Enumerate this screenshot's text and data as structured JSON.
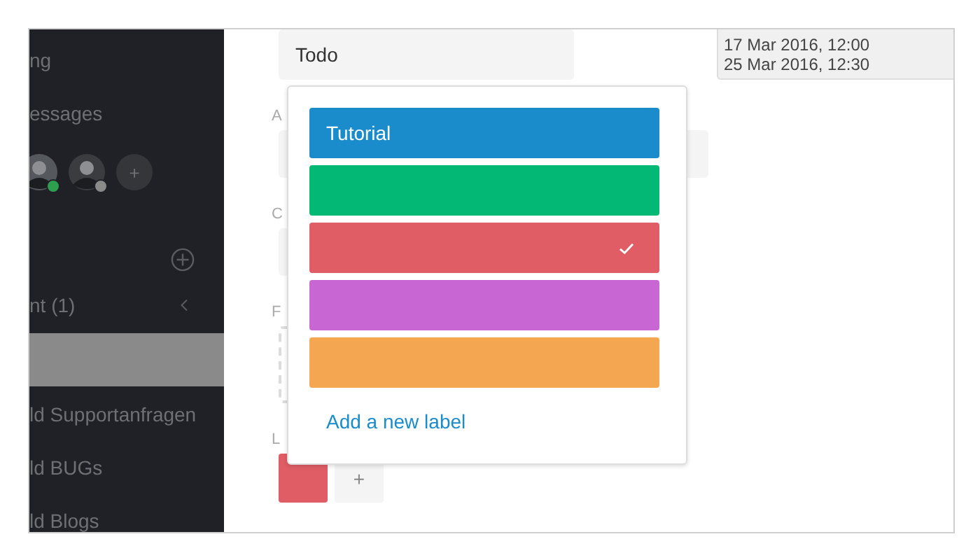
{
  "sidebar": {
    "links": [
      "ng",
      "essages"
    ],
    "avatars": [
      {
        "color": "#2e9e4f"
      },
      {
        "color": "#8a8a8a"
      }
    ],
    "add_member": "+",
    "section": {
      "title": "nt (1)",
      "expanded": false
    },
    "items": [
      {
        "selected": true
      },
      {
        "label": "ld Supportanfragen",
        "selected": false
      },
      {
        "label": "ld BUGs",
        "selected": false
      },
      {
        "label": "ld Blogs",
        "selected": false
      }
    ]
  },
  "card": {
    "list": "Todo",
    "dates": [
      "17 Mar 2016, 12:00",
      "25 Mar 2016, 12:30"
    ],
    "field_labels": [
      "A",
      "C",
      "F",
      "L"
    ],
    "labels": [
      {
        "color": "#e05d65"
      }
    ],
    "add_label": "+"
  },
  "label_popup": {
    "labels": [
      {
        "name": "Tutorial",
        "color": "#1a8bcb",
        "checked": false
      },
      {
        "color": "#03b874",
        "checked": false
      },
      {
        "color": "#e05d65",
        "checked": true
      },
      {
        "color": "#c866d3",
        "checked": false
      },
      {
        "color": "#f4a650",
        "checked": false
      }
    ],
    "add_link": "Add a new label"
  }
}
